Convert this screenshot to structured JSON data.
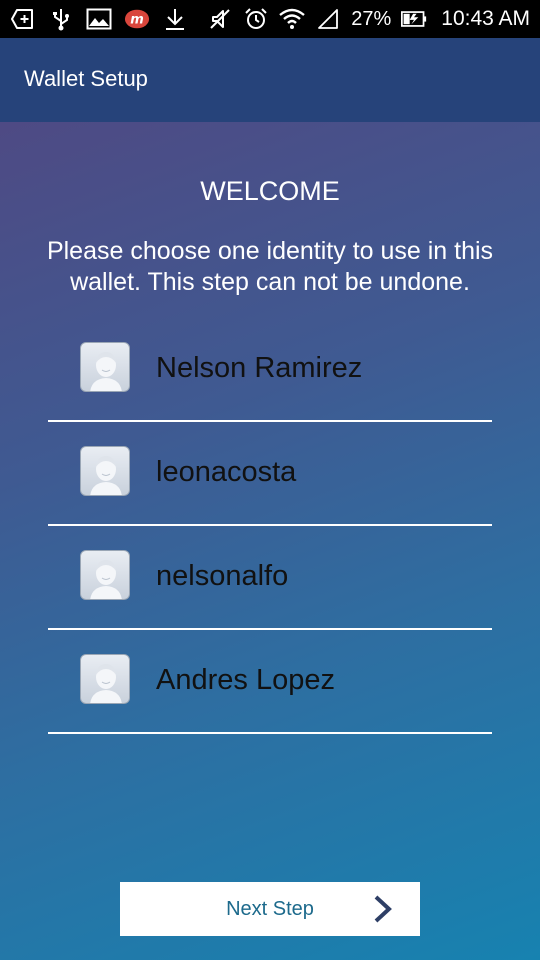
{
  "status_bar": {
    "battery_percent": "27%",
    "time": "10:43 AM",
    "icons_left": [
      "add-box-icon",
      "usb-icon",
      "image-icon",
      "app-m-icon",
      "download-icon"
    ],
    "icons_right": [
      "mute-icon",
      "alarm-icon",
      "wifi-icon",
      "signal-icon",
      "battery-charging-icon"
    ]
  },
  "app_bar": {
    "title": "Wallet Setup"
  },
  "main": {
    "heading": "WELCOME",
    "instructions": "Please choose one identity to use in this wallet. This step can not be undone.",
    "identities": [
      {
        "name": "Nelson Ramirez",
        "icon": "avatar-icon"
      },
      {
        "name": "leonacosta",
        "icon": "avatar-icon"
      },
      {
        "name": "nelsonalfo",
        "icon": "avatar-icon"
      },
      {
        "name": "Andres Lopez",
        "icon": "avatar-icon"
      }
    ]
  },
  "footer": {
    "next_label": "Next Step",
    "next_icon": "chevron-right-icon"
  },
  "colors": {
    "app_bar": "#26437a",
    "gradient_top": "#4e4a84",
    "gradient_bottom": "#1782b0",
    "button_text": "#1d6a8c",
    "app_badge": "#d9463c"
  }
}
